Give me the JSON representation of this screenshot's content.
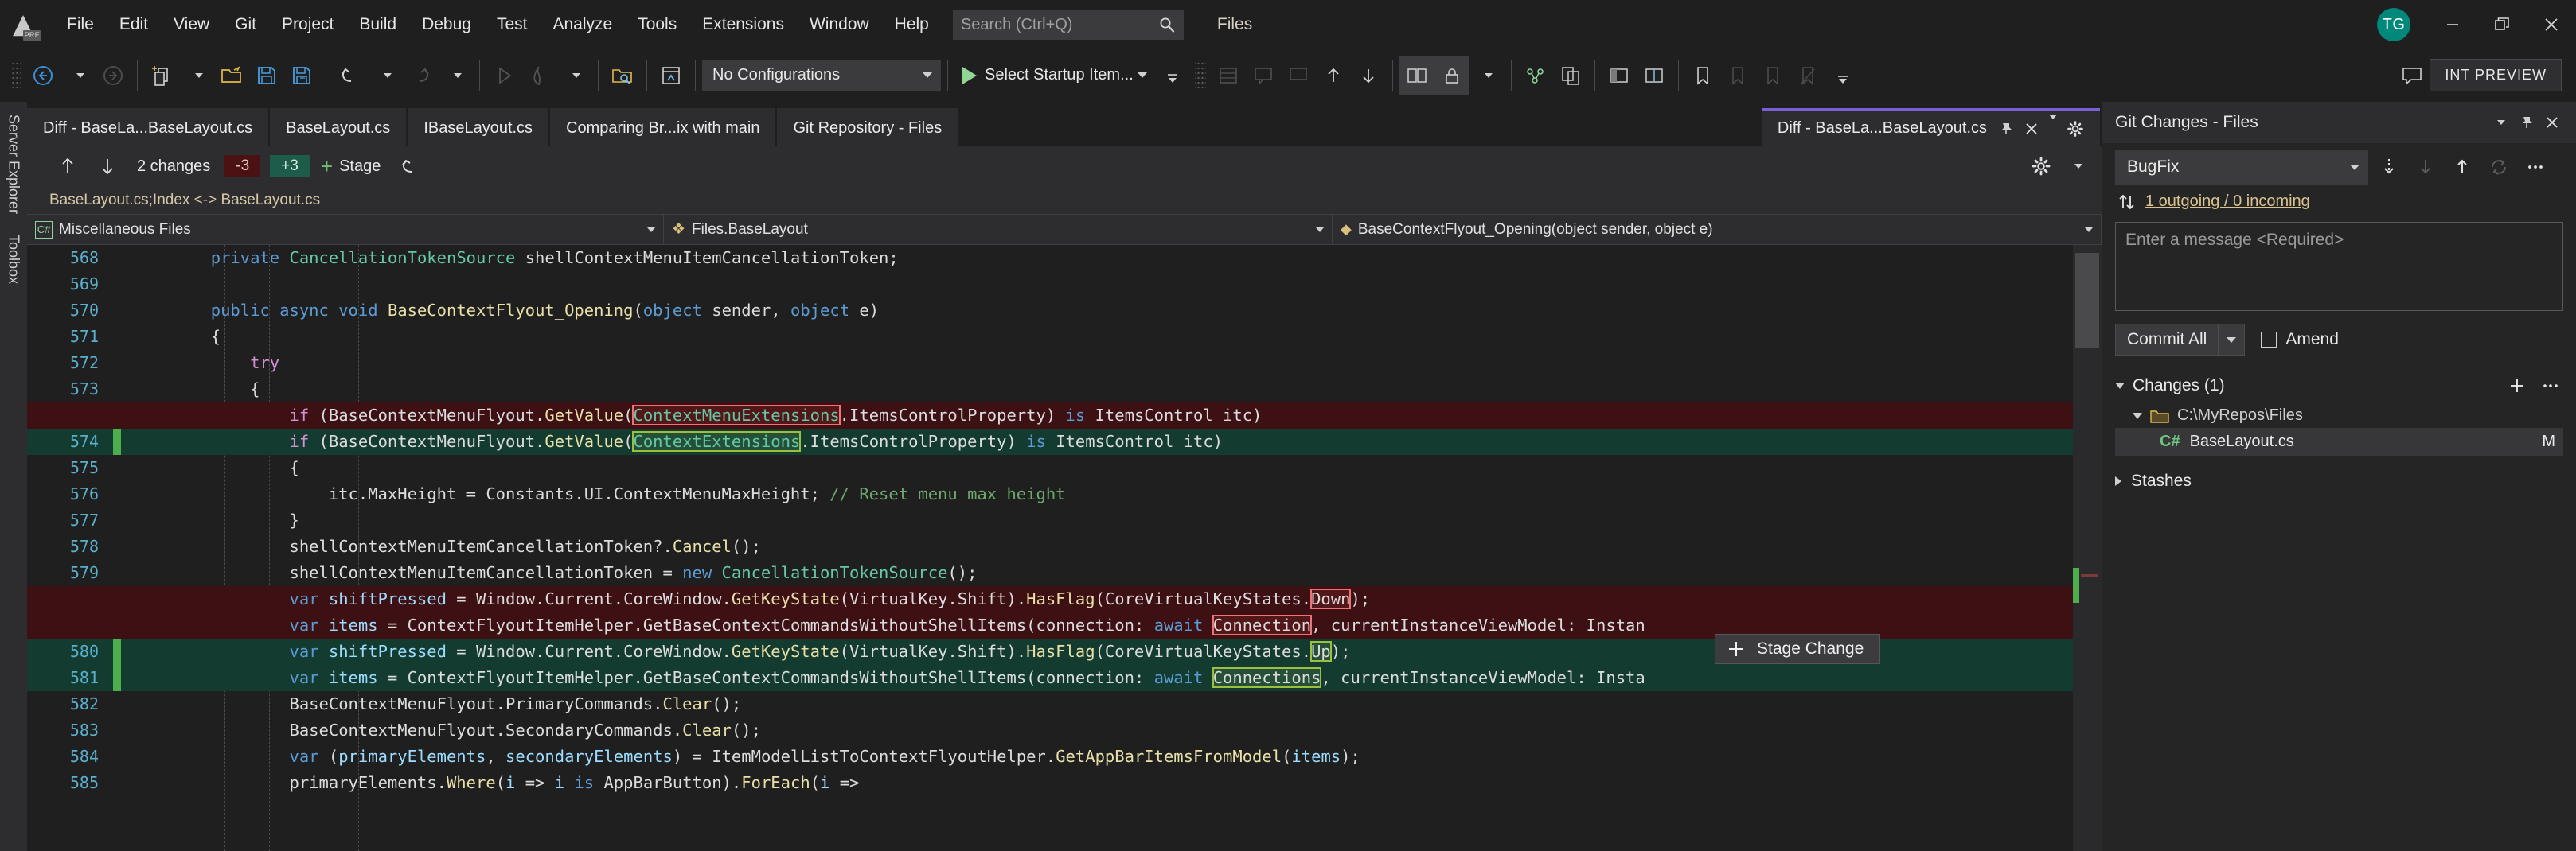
{
  "window": {
    "app_logo_badge": "PRE",
    "solution_name": "Files",
    "avatar_initials": "TG",
    "minimize_label": "Minimize",
    "restore_label": "Restore Down",
    "close_label": "Close"
  },
  "menu": {
    "items": [
      {
        "label": "File"
      },
      {
        "label": "Edit"
      },
      {
        "label": "View"
      },
      {
        "label": "Git"
      },
      {
        "label": "Project"
      },
      {
        "label": "Build"
      },
      {
        "label": "Debug"
      },
      {
        "label": "Test"
      },
      {
        "label": "Analyze"
      },
      {
        "label": "Tools"
      },
      {
        "label": "Extensions"
      },
      {
        "label": "Window"
      },
      {
        "label": "Help"
      }
    ]
  },
  "search": {
    "placeholder": "Search (Ctrl+Q)",
    "icon": "search-icon"
  },
  "toolbar": {
    "configuration": "No Configurations",
    "startup_item": "Select Startup Item...",
    "preview_badge": "INT PREVIEW"
  },
  "tabs": {
    "items": [
      {
        "label": "Diff - BaseLa...BaseLayout.cs",
        "active": false
      },
      {
        "label": "BaseLayout.cs",
        "active": false
      },
      {
        "label": "IBaseLayout.cs",
        "active": false
      },
      {
        "label": "Comparing Br...ix with main",
        "active": false
      },
      {
        "label": "Git Repository - Files",
        "active": false
      }
    ],
    "active_tab": {
      "label": "Diff - BaseLa...BaseLayout.cs"
    }
  },
  "diff_toolbar": {
    "prev_change": "Previous change",
    "next_change": "Next change",
    "changes_count": "2 changes",
    "deletions": "-3",
    "additions": "+3",
    "stage_label": "Stage",
    "revert_label": "Revert",
    "settings_label": "Settings"
  },
  "breadcrumb": {
    "text": "BaseLayout.cs;Index <-> BaseLayout.cs"
  },
  "navbar": {
    "project": "Miscellaneous Files",
    "type": "Files.BaseLayout",
    "member": "BaseContextFlyout_Opening(object sender, object e)"
  },
  "editor": {
    "stage_change_label": "Stage Change",
    "lines": [
      {
        "num": "568",
        "kind": "ctx",
        "tokens": [
          {
            "t": "private ",
            "c": "k"
          },
          {
            "t": "CancellationTokenSource",
            "c": "t"
          },
          {
            "t": " shellContextMenuItemCancellationToken;",
            "c": "p"
          }
        ],
        "indent": 2
      },
      {
        "num": "569",
        "kind": "ctx",
        "tokens": [],
        "indent": 0
      },
      {
        "num": "570",
        "kind": "ctx",
        "tokens": [
          {
            "t": "public ",
            "c": "k"
          },
          {
            "t": "async ",
            "c": "k"
          },
          {
            "t": "void ",
            "c": "k"
          },
          {
            "t": "BaseContextFlyout_Opening",
            "c": "m"
          },
          {
            "t": "(",
            "c": "p"
          },
          {
            "t": "object",
            "c": "k"
          },
          {
            "t": " sender, ",
            "c": "p"
          },
          {
            "t": "object",
            "c": "k"
          },
          {
            "t": " e)",
            "c": "p"
          }
        ],
        "indent": 2
      },
      {
        "num": "571",
        "kind": "ctx",
        "tokens": [
          {
            "t": "{",
            "c": "p"
          }
        ],
        "indent": 2
      },
      {
        "num": "572",
        "kind": "ctx",
        "tokens": [
          {
            "t": "try",
            "c": "kc"
          }
        ],
        "indent": 3
      },
      {
        "num": "573",
        "kind": "ctx",
        "tokens": [
          {
            "t": "{",
            "c": "p"
          }
        ],
        "indent": 3
      },
      {
        "num": "",
        "kind": "del",
        "tokens": [
          {
            "t": "if",
            "c": "kc"
          },
          {
            "t": " (BaseContextMenuFlyout.",
            "c": "p"
          },
          {
            "t": "GetValue",
            "c": "m"
          },
          {
            "t": "(",
            "c": "p"
          },
          {
            "t": "ContextMenuExtensions",
            "c": "t",
            "hl": "del"
          },
          {
            "t": ".ItemsControlProperty) ",
            "c": "p"
          },
          {
            "t": "is",
            "c": "k"
          },
          {
            "t": " ItemsControl itc)",
            "c": "p"
          }
        ],
        "indent": 4
      },
      {
        "num": "574",
        "kind": "add",
        "tokens": [
          {
            "t": "if",
            "c": "kc"
          },
          {
            "t": " (BaseContextMenuFlyout.",
            "c": "p"
          },
          {
            "t": "GetValue",
            "c": "m"
          },
          {
            "t": "(",
            "c": "p"
          },
          {
            "t": "ContextExtensions",
            "c": "t",
            "hl": "add"
          },
          {
            "t": ".ItemsControlProperty) ",
            "c": "p"
          },
          {
            "t": "is",
            "c": "k"
          },
          {
            "t": " ItemsControl itc)",
            "c": "p"
          }
        ],
        "indent": 4
      },
      {
        "num": "575",
        "kind": "ctx",
        "tokens": [
          {
            "t": "{",
            "c": "p"
          }
        ],
        "indent": 4
      },
      {
        "num": "576",
        "kind": "ctx",
        "tokens": [
          {
            "t": "itc.MaxHeight = Constants.UI.ContextMenuMaxHeight; ",
            "c": "p"
          },
          {
            "t": "// Reset menu max height",
            "c": "c"
          }
        ],
        "indent": 5
      },
      {
        "num": "577",
        "kind": "ctx",
        "tokens": [
          {
            "t": "}",
            "c": "p"
          }
        ],
        "indent": 4
      },
      {
        "num": "578",
        "kind": "ctx",
        "tokens": [
          {
            "t": "shellContextMenuItemCancellationToken?.",
            "c": "p"
          },
          {
            "t": "Cancel",
            "c": "m"
          },
          {
            "t": "();",
            "c": "p"
          }
        ],
        "indent": 4
      },
      {
        "num": "579",
        "kind": "ctx",
        "tokens": [
          {
            "t": "shellContextMenuItemCancellationToken = ",
            "c": "p"
          },
          {
            "t": "new",
            "c": "k"
          },
          {
            "t": " ",
            "c": "p"
          },
          {
            "t": "CancellationTokenSource",
            "c": "t"
          },
          {
            "t": "();",
            "c": "p"
          }
        ],
        "indent": 4
      },
      {
        "num": "",
        "kind": "del",
        "tokens": [
          {
            "t": "var",
            "c": "k"
          },
          {
            "t": " ",
            "c": "p"
          },
          {
            "t": "shiftPressed",
            "c": "v"
          },
          {
            "t": " = Window.Current.CoreWindow.",
            "c": "p"
          },
          {
            "t": "GetKeyState",
            "c": "m"
          },
          {
            "t": "(VirtualKey.Shift).",
            "c": "p"
          },
          {
            "t": "HasFlag",
            "c": "m"
          },
          {
            "t": "(CoreVirtualKeyStates.",
            "c": "p"
          },
          {
            "t": "Down",
            "c": "p",
            "hl": "del"
          },
          {
            "t": ");",
            "c": "p"
          }
        ],
        "indent": 4
      },
      {
        "num": "",
        "kind": "del",
        "tokens": [
          {
            "t": "var",
            "c": "k"
          },
          {
            "t": " ",
            "c": "p"
          },
          {
            "t": "items",
            "c": "v"
          },
          {
            "t": " = ContextFlyoutItemHelper.",
            "c": "p"
          },
          {
            "t": "GetBaseContextCommandsWithoutShellItems",
            "c": "p"
          },
          {
            "t": "(connection: ",
            "c": "p"
          },
          {
            "t": "await",
            "c": "k"
          },
          {
            "t": " ",
            "c": "p"
          },
          {
            "t": "Connection",
            "c": "p",
            "hl": "del"
          },
          {
            "t": ", currentInstanceViewModel: Instan",
            "c": "p"
          }
        ],
        "indent": 4
      },
      {
        "num": "580",
        "kind": "add",
        "tokens": [
          {
            "t": "var",
            "c": "k"
          },
          {
            "t": " ",
            "c": "p"
          },
          {
            "t": "shiftPressed",
            "c": "v"
          },
          {
            "t": " = Window.Current.CoreWindow.",
            "c": "p"
          },
          {
            "t": "GetKeyState",
            "c": "m"
          },
          {
            "t": "(VirtualKey.Shift).",
            "c": "p"
          },
          {
            "t": "HasFlag",
            "c": "m"
          },
          {
            "t": "(CoreVirtualKeyStates.",
            "c": "p"
          },
          {
            "t": "Up",
            "c": "p",
            "hl": "add"
          },
          {
            "t": ");",
            "c": "p"
          }
        ],
        "indent": 4
      },
      {
        "num": "581",
        "kind": "add",
        "tokens": [
          {
            "t": "var",
            "c": "k"
          },
          {
            "t": " ",
            "c": "p"
          },
          {
            "t": "items",
            "c": "v"
          },
          {
            "t": " = ContextFlyoutItemHelper.",
            "c": "p"
          },
          {
            "t": "GetBaseContextCommandsWithoutShellItems",
            "c": "p"
          },
          {
            "t": "(connection: ",
            "c": "p"
          },
          {
            "t": "await",
            "c": "k"
          },
          {
            "t": " ",
            "c": "p"
          },
          {
            "t": "Connections",
            "c": "p",
            "hl": "add"
          },
          {
            "t": ", currentInstanceViewModel: Insta",
            "c": "p"
          }
        ],
        "indent": 4
      },
      {
        "num": "582",
        "kind": "ctx",
        "tokens": [
          {
            "t": "BaseContextMenuFlyout.PrimaryCommands.",
            "c": "p"
          },
          {
            "t": "Clear",
            "c": "m"
          },
          {
            "t": "();",
            "c": "p"
          }
        ],
        "indent": 4
      },
      {
        "num": "583",
        "kind": "ctx",
        "tokens": [
          {
            "t": "BaseContextMenuFlyout.SecondaryCommands.",
            "c": "p"
          },
          {
            "t": "Clear",
            "c": "m"
          },
          {
            "t": "();",
            "c": "p"
          }
        ],
        "indent": 4
      },
      {
        "num": "584",
        "kind": "ctx",
        "tokens": [
          {
            "t": "var",
            "c": "k"
          },
          {
            "t": " (",
            "c": "p"
          },
          {
            "t": "primaryElements",
            "c": "v"
          },
          {
            "t": ", ",
            "c": "p"
          },
          {
            "t": "secondaryElements",
            "c": "v"
          },
          {
            "t": ") = ItemModelListToContextFlyoutHelper.",
            "c": "p"
          },
          {
            "t": "GetAppBarItemsFromModel",
            "c": "m"
          },
          {
            "t": "(",
            "c": "p"
          },
          {
            "t": "items",
            "c": "v"
          },
          {
            "t": ");",
            "c": "p"
          }
        ],
        "indent": 4
      },
      {
        "num": "585",
        "kind": "ctx",
        "tokens": [
          {
            "t": "primaryElements.",
            "c": "p"
          },
          {
            "t": "Where",
            "c": "m"
          },
          {
            "t": "(",
            "c": "p"
          },
          {
            "t": "i",
            "c": "v"
          },
          {
            "t": " => ",
            "c": "p"
          },
          {
            "t": "i",
            "c": "v"
          },
          {
            "t": " ",
            "c": "p"
          },
          {
            "t": "is",
            "c": "k"
          },
          {
            "t": " AppBarButton).",
            "c": "p"
          },
          {
            "t": "ForEach",
            "c": "m"
          },
          {
            "t": "(",
            "c": "p"
          },
          {
            "t": "i",
            "c": "v"
          },
          {
            "t": " =>",
            "c": "p"
          }
        ],
        "indent": 4
      }
    ]
  },
  "left_rail": {
    "items": [
      {
        "label": "Server Explorer"
      },
      {
        "label": "Toolbox"
      }
    ]
  },
  "git_panel": {
    "title": "Git Changes - Files",
    "branch": "BugFix",
    "sync_status": "1 outgoing / 0 incoming",
    "message_placeholder": "Enter a message <Required>",
    "commit_button": "Commit All",
    "amend_label": "Amend",
    "changes_header": "Changes (1)",
    "folder": "C:\\MyRepos\\Files",
    "file": {
      "name": "BaseLayout.cs",
      "status": "M",
      "language_glyph": "C#"
    },
    "stashes_label": "Stashes"
  },
  "colors": {
    "accent_purple": "#7b5fd4",
    "add_bg": "#133b30",
    "del_bg": "#3d1013",
    "badge_add": "#1d5b4b",
    "badge_del": "#4b1113",
    "avatar": "#00897b"
  }
}
